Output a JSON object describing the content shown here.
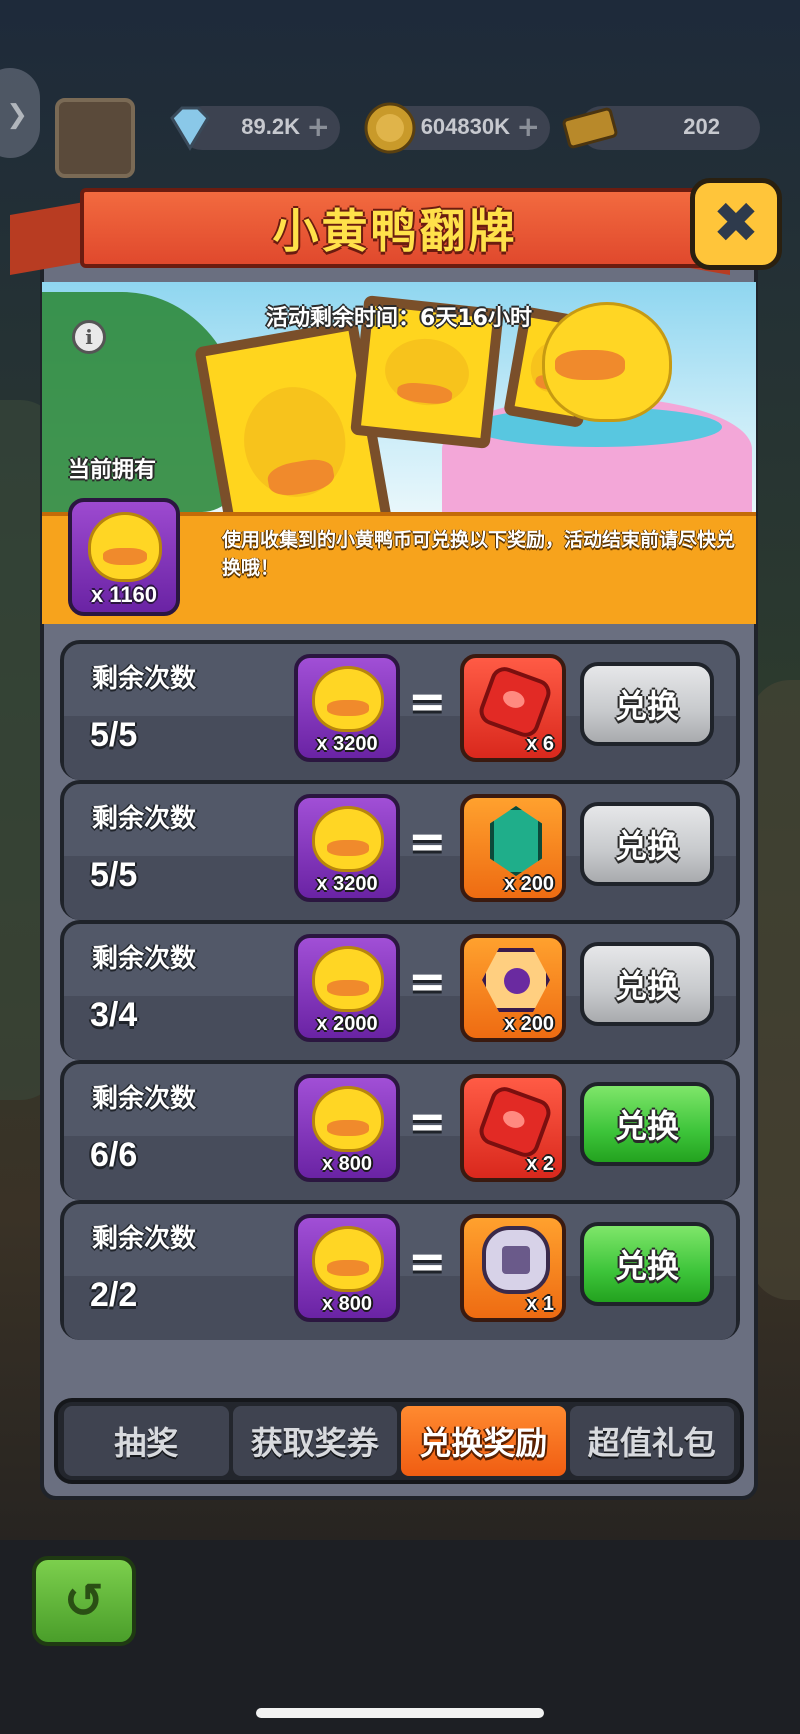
{
  "resources": {
    "gems": "89.2K",
    "coins": "604830K",
    "tickets": "202",
    "plus": "+"
  },
  "header": {
    "title": "小黄鸭翻牌",
    "close_glyph": "✖"
  },
  "banner": {
    "timer": "活动剩余时间：6天16小时",
    "info_glyph": "i"
  },
  "owned": {
    "label": "当前拥有",
    "quantity": "x 1160"
  },
  "info_text": "使用收集到的小黄鸭币可兑换以下奖励，活动结束前请尽快兑换哦！",
  "rows": [
    {
      "label": "剩余次数",
      "count": "5/5",
      "cost": "x 3200",
      "reward_qty": "x 6",
      "button": "兑换"
    },
    {
      "label": "剩余次数",
      "count": "5/5",
      "cost": "x 3200",
      "reward_qty": "x 200",
      "button": "兑换"
    },
    {
      "label": "剩余次数",
      "count": "3/4",
      "cost": "x 2000",
      "reward_qty": "x 200",
      "button": "兑换"
    },
    {
      "label": "剩余次数",
      "count": "6/6",
      "cost": "x 800",
      "reward_qty": "x 2",
      "button": "兑换"
    },
    {
      "label": "剩余次数",
      "count": "2/2",
      "cost": "x 800",
      "reward_qty": "x 1",
      "button": "兑换"
    }
  ],
  "equals": "=",
  "tabs": [
    "抽奖",
    "获取奖券",
    "兑换奖励",
    "超值礼包"
  ],
  "colors": {
    "active_tab": "#f05d12",
    "button_enabled": "#3dc43a",
    "button_disabled": "#c7c9cc",
    "title_text": "#ffe14a"
  }
}
